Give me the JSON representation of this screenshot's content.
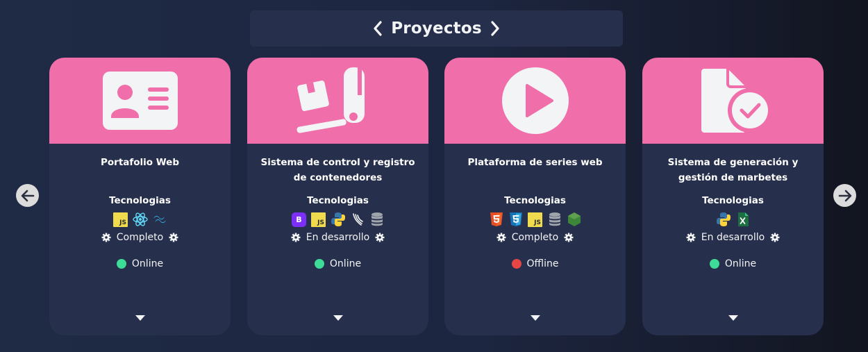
{
  "header": {
    "title": "Proyectos"
  },
  "colors": {
    "accent": "#f06ea9",
    "card_bg": "#262f4b",
    "online": "#3ddc97",
    "offline": "#e84545"
  },
  "tech_label": "Tecnologias",
  "cards": [
    {
      "title": "Portafolio Web",
      "icon": "id-card-icon",
      "technologies": [
        "javascript-icon",
        "react-icon",
        "tailwind-icon"
      ],
      "js_text": "JS",
      "status": "Completo",
      "availability": "Online"
    },
    {
      "title": "Sistema de control y registro de contenedores",
      "icon": "hand-truck-icon",
      "technologies": [
        "bootstrap-icon",
        "javascript-icon",
        "python-icon",
        "flask-icon",
        "database-icon"
      ],
      "js_text": "JS",
      "bs_text": "B",
      "status": "En desarrollo",
      "availability": "Online"
    },
    {
      "title": "Plataforma de series web",
      "icon": "play-circle-icon",
      "technologies": [
        "html5-icon",
        "css3-icon",
        "javascript-icon",
        "database-icon",
        "nodejs-icon"
      ],
      "js_text": "JS",
      "status": "Completo",
      "availability": "Offline"
    },
    {
      "title": "Sistema de generación y gestión de marbetes",
      "icon": "file-check-icon",
      "technologies": [
        "python-icon",
        "excel-icon"
      ],
      "status": "En desarrollo",
      "availability": "Online"
    }
  ]
}
